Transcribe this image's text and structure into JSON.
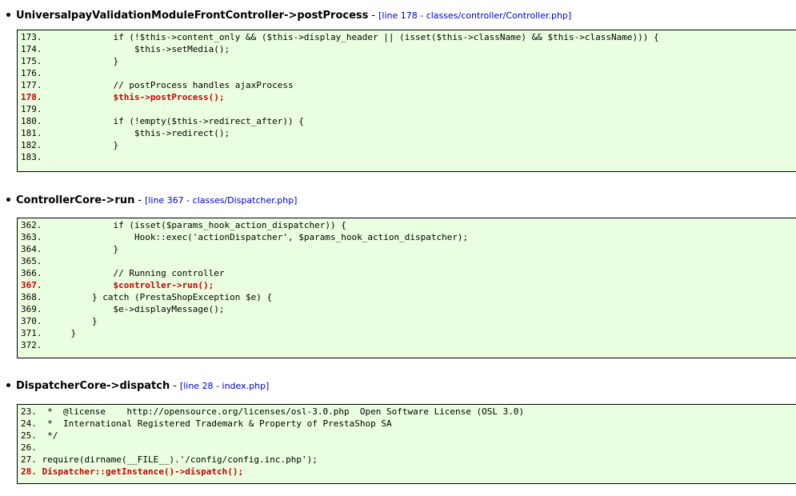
{
  "traces": [
    {
      "function": "UniversalpayValidationModuleFrontController->postProcess",
      "separator": "-",
      "location": "[line 178 - classes/controller/Controller.php]",
      "lines": [
        {
          "num": "173.",
          "code": "            if (!$this->content_only && ($this->display_header || (isset($this->className) && $this->className))) {",
          "highlight": false
        },
        {
          "num": "174.",
          "code": "                $this->setMedia();",
          "highlight": false
        },
        {
          "num": "175.",
          "code": "            }",
          "highlight": false
        },
        {
          "num": "176.",
          "code": "",
          "highlight": false
        },
        {
          "num": "177.",
          "code": "            // postProcess handles ajaxProcess",
          "highlight": false
        },
        {
          "num": "178.",
          "code": "            $this->postProcess();",
          "highlight": true
        },
        {
          "num": "179.",
          "code": "",
          "highlight": false
        },
        {
          "num": "180.",
          "code": "            if (!empty($this->redirect_after)) {",
          "highlight": false
        },
        {
          "num": "181.",
          "code": "                $this->redirect();",
          "highlight": false
        },
        {
          "num": "182.",
          "code": "            }",
          "highlight": false
        },
        {
          "num": "183.",
          "code": "",
          "highlight": false
        }
      ]
    },
    {
      "function": "ControllerCore->run",
      "separator": "-",
      "location": "[line 367 - classes/Dispatcher.php]",
      "lines": [
        {
          "num": "362.",
          "code": "            if (isset($params_hook_action_dispatcher)) {",
          "highlight": false
        },
        {
          "num": "363.",
          "code": "                Hook::exec('actionDispatcher', $params_hook_action_dispatcher);",
          "highlight": false
        },
        {
          "num": "364.",
          "code": "            }",
          "highlight": false
        },
        {
          "num": "365.",
          "code": "",
          "highlight": false
        },
        {
          "num": "366.",
          "code": "            // Running controller",
          "highlight": false
        },
        {
          "num": "367.",
          "code": "            $controller->run();",
          "highlight": true
        },
        {
          "num": "368.",
          "code": "        } catch (PrestaShopException $e) {",
          "highlight": false
        },
        {
          "num": "369.",
          "code": "            $e->displayMessage();",
          "highlight": false
        },
        {
          "num": "370.",
          "code": "        }",
          "highlight": false
        },
        {
          "num": "371.",
          "code": "    }",
          "highlight": false
        },
        {
          "num": "372.",
          "code": "",
          "highlight": false
        }
      ]
    },
    {
      "function": "DispatcherCore->dispatch",
      "separator": "-",
      "location": "[line 28 - index.php]",
      "lines": [
        {
          "num": "23.",
          "code": " *  @license    http://opensource.org/licenses/osl-3.0.php  Open Software License (OSL 3.0)",
          "highlight": false
        },
        {
          "num": "24.",
          "code": " *  International Registered Trademark & Property of PrestaShop SA",
          "highlight": false
        },
        {
          "num": "25.",
          "code": " */",
          "highlight": false
        },
        {
          "num": "26.",
          "code": "",
          "highlight": false
        },
        {
          "num": "27.",
          "code": "require(dirname(__FILE__).'/config/config.inc.php');",
          "highlight": false
        },
        {
          "num": "28.",
          "code": "Dispatcher::getInstance()->dispatch();",
          "highlight": true
        }
      ]
    }
  ]
}
